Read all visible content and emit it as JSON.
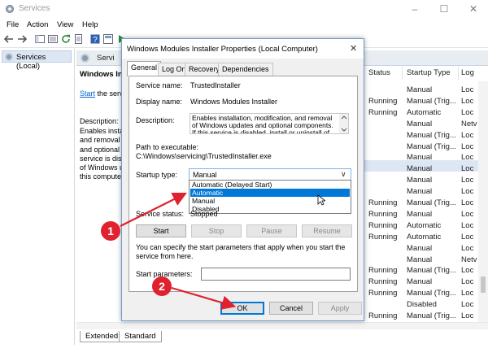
{
  "window": {
    "title": "Services",
    "controls": {
      "minimize": "–",
      "maximize": "☐",
      "close": "✕"
    }
  },
  "menu": [
    "File",
    "Action",
    "View",
    "Help"
  ],
  "tree": {
    "root": "Services (Local)"
  },
  "header": {
    "label": "Servi"
  },
  "detail": {
    "title": "Windows Insta",
    "start_link": "Start",
    "start_rest": " the serv",
    "desc_label": "Description:",
    "desc_lines": [
      "Enables insta",
      "and removal",
      "and optional",
      "service is disa",
      "of Windows u",
      "this compute"
    ]
  },
  "columns": {
    "status": "Status",
    "startup": "Startup Type",
    "logon": "Log"
  },
  "rows": [
    {
      "status": "",
      "startup": "Manual",
      "logon": "Loc"
    },
    {
      "status": "Running",
      "startup": "Manual (Trig...",
      "logon": "Loc"
    },
    {
      "status": "Running",
      "startup": "Automatic",
      "logon": "Loc"
    },
    {
      "status": "",
      "startup": "Manual",
      "logon": "Netv"
    },
    {
      "status": "",
      "startup": "Manual (Trig...",
      "logon": "Loc"
    },
    {
      "status": "",
      "startup": "Manual (Trig...",
      "logon": "Loc"
    },
    {
      "status": "",
      "startup": "Manual",
      "logon": "Loc"
    },
    {
      "status": "",
      "startup": "Manual",
      "logon": "Loc"
    },
    {
      "status": "",
      "startup": "Manual",
      "logon": "Loc"
    },
    {
      "status": "",
      "startup": "Manual",
      "logon": "Loc"
    },
    {
      "status": "Running",
      "startup": "Manual (Trig...",
      "logon": "Loc"
    },
    {
      "status": "Running",
      "startup": "Manual",
      "logon": "Loc"
    },
    {
      "status": "Running",
      "startup": "Automatic",
      "logon": "Loc"
    },
    {
      "status": "Running",
      "startup": "Automatic",
      "logon": "Loc"
    },
    {
      "status": "",
      "startup": "Manual",
      "logon": "Loc"
    },
    {
      "status": "",
      "startup": "Manual",
      "logon": "Netv"
    },
    {
      "status": "Running",
      "startup": "Manual (Trig...",
      "logon": "Loc"
    },
    {
      "status": "Running",
      "startup": "Manual",
      "logon": "Loc"
    },
    {
      "status": "Running",
      "startup": "Manual (Trig...",
      "logon": "Loc"
    },
    {
      "status": "",
      "startup": "Disabled",
      "logon": "Loc"
    },
    {
      "status": "Running",
      "startup": "Manual (Trig...",
      "logon": "Loc"
    }
  ],
  "bottom_tabs": [
    "Extended",
    "Standard"
  ],
  "dialog": {
    "title": "Windows Modules Installer Properties (Local Computer)",
    "close": "✕",
    "tabs": [
      "General",
      "Log On",
      "Recovery",
      "Dependencies"
    ],
    "service_name_label": "Service name:",
    "service_name": "TrustedInstaller",
    "display_name_label": "Display name:",
    "display_name": "Windows Modules Installer",
    "description_label": "Description:",
    "description_text": "Enables installation, modification, and removal of Windows updates and optional components. If this service is disabled, install or uninstall of Windows",
    "path_label": "Path to executable:",
    "path": "C:\\Windows\\servicing\\TrustedInstaller.exe",
    "startup_type_label": "Startup type:",
    "startup_type_value": "Manual",
    "startup_options": [
      "Automatic (Delayed Start)",
      "Automatic",
      "Manual",
      "Disabled"
    ],
    "startup_highlighted": "Automatic",
    "service_status_label": "Service status:",
    "service_status": "Stopped",
    "buttons": {
      "start": "Start",
      "stop": "Stop",
      "pause": "Pause",
      "resume": "Resume"
    },
    "hint": "You can specify the start parameters that apply when you start the service from here.",
    "start_params_label": "Start parameters:",
    "start_params_value": "",
    "ok": "OK",
    "cancel": "Cancel",
    "apply": "Apply"
  },
  "annotations": {
    "badge1": "1",
    "badge2": "2",
    "color": "#e0212e"
  }
}
